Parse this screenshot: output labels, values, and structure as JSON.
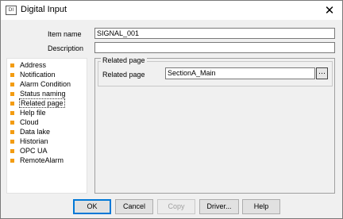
{
  "window": {
    "title": "Digital Input",
    "icon_text": "DI",
    "close_glyph": "✕"
  },
  "form": {
    "item_name_label": "Item name",
    "item_name_value": "SIGNAL_001",
    "description_label": "Description",
    "description_value": ""
  },
  "nav": {
    "bullet_color": "#f39c12",
    "items": [
      {
        "label": "Address"
      },
      {
        "label": "Notification"
      },
      {
        "label": "Alarm Condition"
      },
      {
        "label": "Status naming"
      },
      {
        "label": "Related page",
        "selected": true
      },
      {
        "label": "Help file"
      },
      {
        "label": "Cloud"
      },
      {
        "label": "Data lake"
      },
      {
        "label": "Historian"
      },
      {
        "label": "OPC UA"
      },
      {
        "label": "RemoteAlarm"
      }
    ]
  },
  "related_page": {
    "group_title": "Related page",
    "field_label": "Related page",
    "field_value": "SectionA_Main",
    "browse_glyph": "…"
  },
  "buttons": {
    "ok": "OK",
    "cancel": "Cancel",
    "copy": "Copy",
    "driver": "Driver...",
    "help": "Help"
  }
}
